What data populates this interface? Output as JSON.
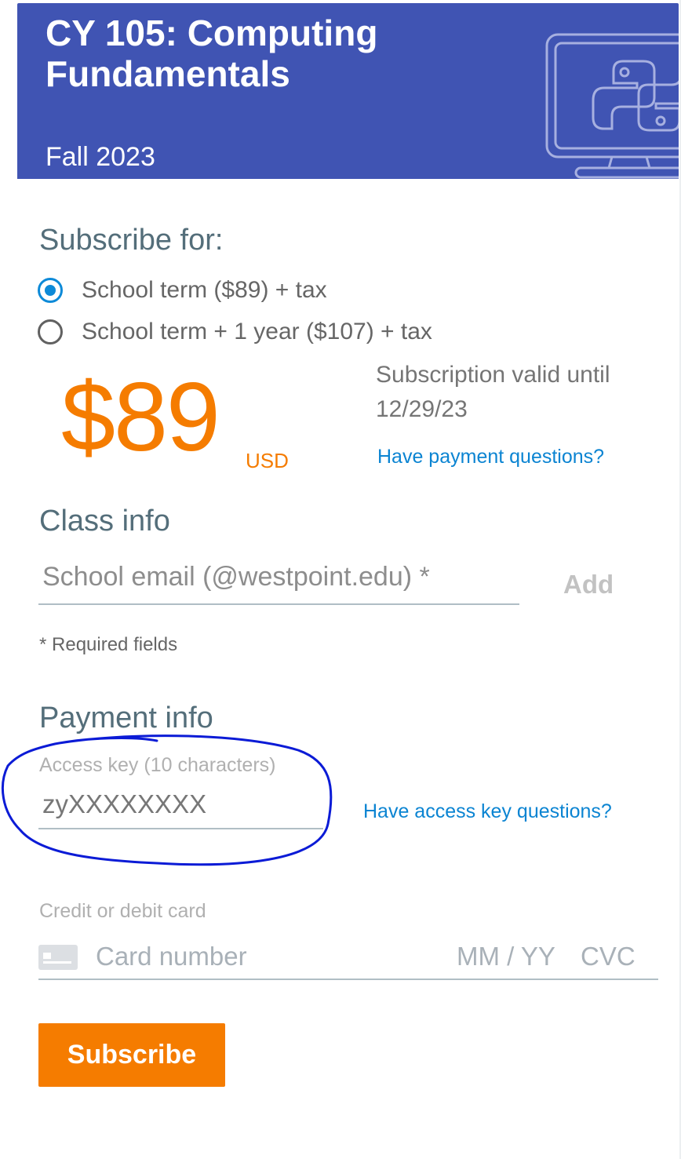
{
  "header": {
    "course_title": "CY 105: Computing Fundamentals",
    "term": "Fall 2023",
    "icon": "python-monitor-icon",
    "color": "#4054b3"
  },
  "subscribe": {
    "heading": "Subscribe for:",
    "options": [
      {
        "label": "School term ($89) + tax",
        "selected": true
      },
      {
        "label": "School term + 1 year ($107) + tax",
        "selected": false
      }
    ],
    "price": "$89",
    "currency": "USD",
    "valid_until": "Subscription valid until 12/29/23",
    "payment_questions_link": "Have payment questions?",
    "accent_color": "#f57c00"
  },
  "class_info": {
    "heading": "Class info",
    "email_placeholder": "School email (@westpoint.edu) *",
    "add_label": "Add",
    "required_note": "* Required fields"
  },
  "payment_info": {
    "heading": "Payment info",
    "access_key_label": "Access key (10 characters)",
    "access_key_value": "zyXXXXXXXX",
    "access_key_questions_link": "Have access key questions?",
    "card_label": "Credit or debit card",
    "card_number_placeholder": "Card number",
    "expiry_placeholder": "MM / YY",
    "cvc_placeholder": "CVC",
    "annotation_color": "#0b1bd6"
  },
  "actions": {
    "subscribe_label": "Subscribe"
  }
}
